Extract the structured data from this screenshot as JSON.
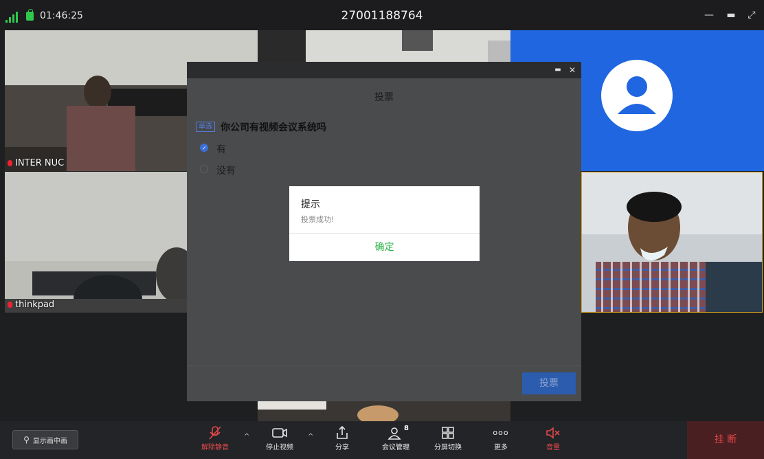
{
  "titlebar": {
    "timer": "01:46:25",
    "meeting_id": "27001188764"
  },
  "tiles": [
    {
      "name": "INTER NUC"
    },
    {
      "name": "thinkpad"
    }
  ],
  "poll": {
    "title": "投票",
    "question_tag": "单选",
    "question": "你公司有视频会议系统吗",
    "options": [
      "有",
      "没有"
    ],
    "selected_index": 0,
    "submit_label": "投票"
  },
  "dialog": {
    "title": "提示",
    "message": "投票成功!",
    "ok_label": "确定"
  },
  "toolbar": {
    "gallery_label": "显示画中画",
    "unmute_label": "解除静音",
    "stop_video_label": "停止视频",
    "share_label": "分享",
    "manage_label": "会议管理",
    "participant_count": "8",
    "layout_label": "分屏切换",
    "more_label": "更多",
    "volume_label": "音量",
    "hangup_label": "挂 断"
  },
  "colors": {
    "accent_green": "#2fb34a",
    "alert_red": "#e0484a",
    "poll_blue": "#2b5cae",
    "avatar_blue": "#1f66e0"
  }
}
